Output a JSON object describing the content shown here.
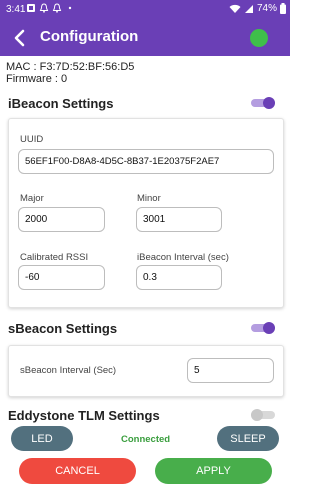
{
  "status_bar": {
    "time": "3:41",
    "battery": "74%"
  },
  "header": {
    "title": "Configuration"
  },
  "device": {
    "mac": "MAC : F3:7D:52:BF:56:D5",
    "firmware": "Firmware : 0"
  },
  "ibeacon": {
    "title": "iBeacon Settings",
    "enabled": true,
    "uuid_label": "UUID",
    "uuid_value": "56EF1F00-D8A8-4D5C-8B37-1E20375F2AE7",
    "major_label": "Major",
    "major_value": "2000",
    "minor_label": "Minor",
    "minor_value": "3001",
    "rssi_label": "Calibrated RSSI",
    "rssi_value": "-60",
    "interval_label": "iBeacon Interval (sec)",
    "interval_value": "0.3"
  },
  "sbeacon": {
    "title": "sBeacon Settings",
    "enabled": true,
    "interval_label": "sBeacon Interval (Sec)",
    "interval_value": "5"
  },
  "eddystone": {
    "title": "Eddystone TLM Settings",
    "enabled": false
  },
  "footer": {
    "led_label": "LED",
    "connection_status": "Connected",
    "sleep_label": "SLEEP",
    "cancel_label": "CANCEL",
    "apply_label": "APPLY"
  },
  "colors": {
    "primary": "#6a3fb6",
    "connected_dot": "#3fbf4a",
    "cancel": "#ef4a3f",
    "apply": "#48ae4b",
    "secondary_button": "#52707e"
  }
}
